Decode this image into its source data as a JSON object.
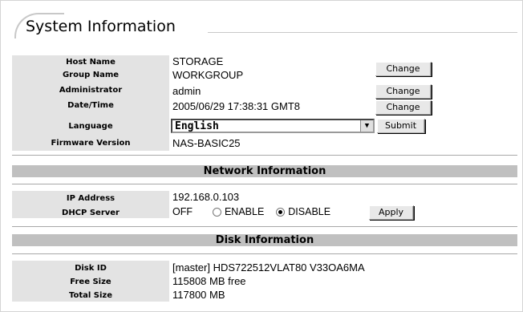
{
  "title": "System Information",
  "system": {
    "host_name_label": "Host Name",
    "host_name": "STORAGE",
    "group_name_label": "Group Name",
    "group_name": "WORKGROUP",
    "administrator_label": "Administrator",
    "administrator": "admin",
    "datetime_label": "Date/Time",
    "datetime": "2005/06/29 17:38:31 GMT8",
    "language_label": "Language",
    "language": "English",
    "firmware_label": "Firmware Version",
    "firmware": "NAS-BASIC25",
    "change_label": "Change",
    "submit_label": "Submit"
  },
  "network": {
    "header": "Network Information",
    "ip_label": "IP Address",
    "ip": "192.168.0.103",
    "dhcp_label": "DHCP Server",
    "dhcp_state": "OFF",
    "enable_label": "ENABLE",
    "disable_label": "DISABLE",
    "apply_label": "Apply"
  },
  "disk": {
    "header": "Disk Information",
    "id_label": "Disk ID",
    "id": "[master] HDS722512VLAT80 V33OA6MA",
    "free_label": "Free Size",
    "free": "115808 MB free",
    "total_label": "Total Size",
    "total": "117800 MB"
  }
}
